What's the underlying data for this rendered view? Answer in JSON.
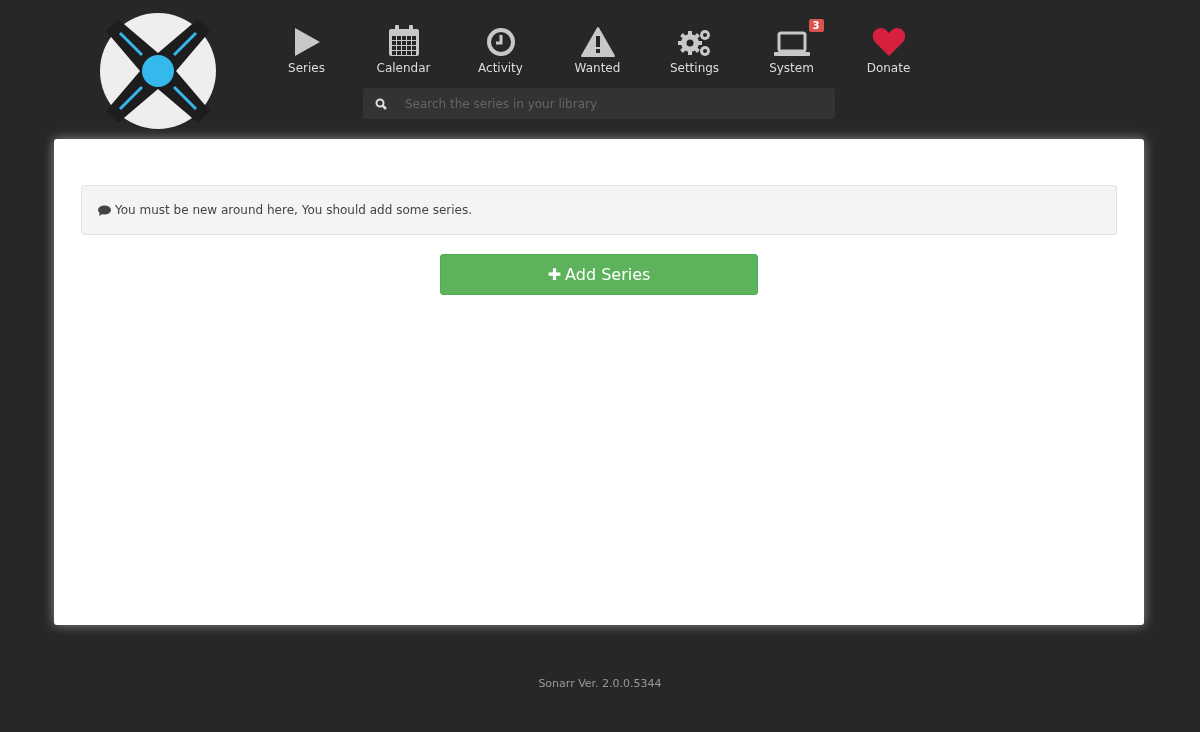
{
  "nav": [
    {
      "kind": "series",
      "label": "Series"
    },
    {
      "kind": "calendar",
      "label": "Calendar"
    },
    {
      "kind": "activity",
      "label": "Activity"
    },
    {
      "kind": "wanted",
      "label": "Wanted"
    },
    {
      "kind": "settings",
      "label": "Settings"
    },
    {
      "kind": "system",
      "label": "System",
      "badge": "3"
    },
    {
      "kind": "donate",
      "label": "Donate"
    }
  ],
  "search": {
    "placeholder": "Search the series in your library"
  },
  "notice": "You must be new around here, You should add some series.",
  "add_button": {
    "icon": "✚",
    "label": "Add Series"
  },
  "footer": "Sonarr Ver. 2.0.0.5344"
}
